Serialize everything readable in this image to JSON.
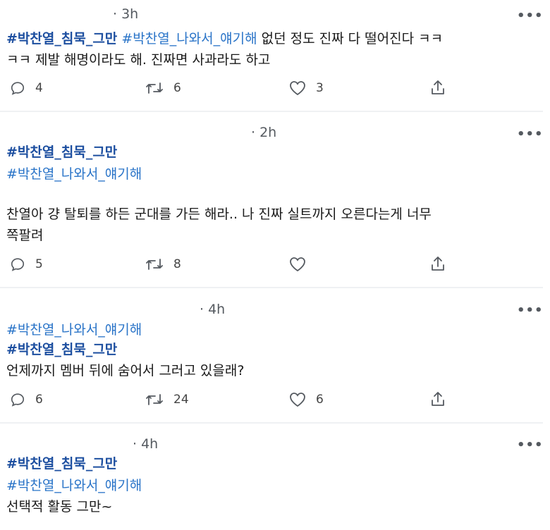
{
  "tweets": [
    {
      "time": "· 3h",
      "line1": {
        "tag_bold": "#박찬열_침묵_그만",
        "tag_light": "#박찬열_나와서_얘기해",
        "text": "없던 정도 진짜 다 떨어진다 ㅋㅋ"
      },
      "line2": "ㅋㅋ 제발 해명이라도 해. 진짜면 사과라도 하고",
      "replies": "4",
      "retweets": "6",
      "likes": "3"
    },
    {
      "time": "· 2h",
      "tag_bold": "#박찬열_침묵_그만",
      "tag_light": "#박찬열_나와서_얘기해",
      "body_line1": "찬열아 걍 탈퇴를 하든 군대를 가든 해라.. 나 진짜 실트까지 오른다는게 너무",
      "body_line2": "쪽팔려",
      "replies": "5",
      "retweets": "8",
      "likes": ""
    },
    {
      "time": "· 4h",
      "tag_light": "#박찬열_나와서_얘기해",
      "tag_bold": "#박찬열_침묵_그만",
      "body": "언제까지 멤버 뒤에 숨어서 그러고 있을래?",
      "replies": "6",
      "retweets": "24",
      "likes": "6"
    },
    {
      "time": "· 4h",
      "tag_bold": "#박찬열_침묵_그만",
      "tag_light": "#박찬열_나와서_얘기해",
      "body": "선택적 활동 그만~"
    }
  ],
  "more_glyph": "•••",
  "icons": {
    "reply": "reply-icon",
    "retweet": "retweet-icon",
    "like": "heart-icon",
    "share": "share-icon"
  }
}
